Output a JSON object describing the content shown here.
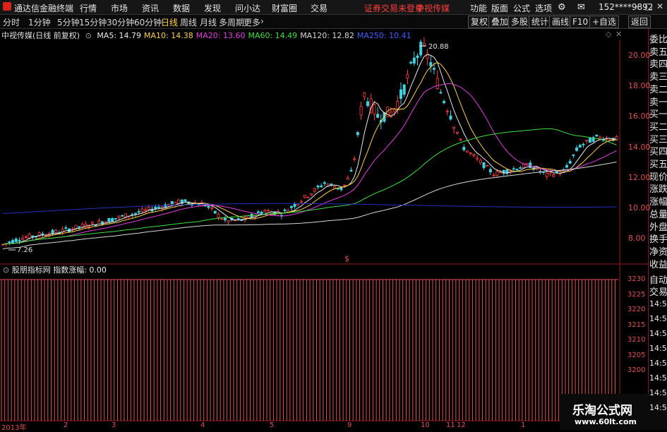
{
  "app": {
    "name": "通达信金融终端"
  },
  "menu": [
    "行情",
    "市场",
    "资讯",
    "数据",
    "发现",
    "问小达",
    "财富圈",
    "交易"
  ],
  "warning": "证券交易未登录",
  "stock_tag": "中视传媒",
  "right_menu": [
    "功能",
    "版面",
    "公式",
    "选项"
  ],
  "user": "152****9892",
  "periods": [
    "分时",
    "1分钟",
    "5分钟",
    "15分钟",
    "30分钟",
    "60分钟",
    "日线",
    "周线",
    "月线",
    "多周期",
    "更多"
  ],
  "active_period": "日线",
  "tools": [
    "复权",
    "叠加",
    "多股",
    "统计",
    "画线",
    "F10",
    "+自选",
    "返回"
  ],
  "chart_title": "中视传媒(日线 前复权)",
  "ma_legend": [
    {
      "label": "MA5: 14.79",
      "color": "#e8e8e8"
    },
    {
      "label": "MA10: 14.38",
      "color": "#ffd04a"
    },
    {
      "label": "MA20: 13.60",
      "color": "#e040e0"
    },
    {
      "label": "MA60: 14.49",
      "color": "#40e040"
    },
    {
      "label": "MA120: 12.82",
      "color": "#d8d8d8"
    },
    {
      "label": "MA250: 10.41",
      "color": "#4060ff"
    }
  ],
  "right_panel_top": [
    "委比",
    "卖五",
    "卖四",
    "卖三",
    "卖二",
    "卖一",
    "买一",
    "买二",
    "买三",
    "买四",
    "买五",
    "现价",
    "涨跌",
    "涨幅",
    "总量",
    "外盘",
    "换手",
    "净资",
    "收益"
  ],
  "right_panel_bottom": [
    "自动",
    "交易"
  ],
  "indicator": {
    "name": "股朋指标网",
    "label": "指数涨幅: 0.00"
  },
  "chart_data": {
    "type": "candlestick",
    "y_ticks": [
      "20.00",
      "18.00",
      "16.00",
      "14.00",
      "12.00",
      "10.00",
      "8.00"
    ],
    "high_label": "20.88",
    "low_label": "7.26",
    "indicator_ticks": [
      "3230",
      "3225",
      "3220",
      "3215",
      "3210",
      "3205",
      "3200"
    ],
    "x_labels": [
      "2013年",
      "2",
      "3",
      "4",
      "5",
      "9",
      "10",
      "11",
      "12",
      "1"
    ],
    "ma_colors": {
      "ma5": "#e8e8e8",
      "ma10": "#ffd04a",
      "ma20": "#e040e0",
      "ma60": "#40e040",
      "ma120": "#d8d8d8",
      "ma250": "#2030c0"
    }
  },
  "trade_times": [
    "14:56",
    "14:56",
    "14:56",
    "14:56",
    "14:56",
    "14:56",
    "14:56",
    "14:56"
  ],
  "brand": {
    "line1": "乐淘公式网",
    "line2": "www.60lt.com"
  }
}
